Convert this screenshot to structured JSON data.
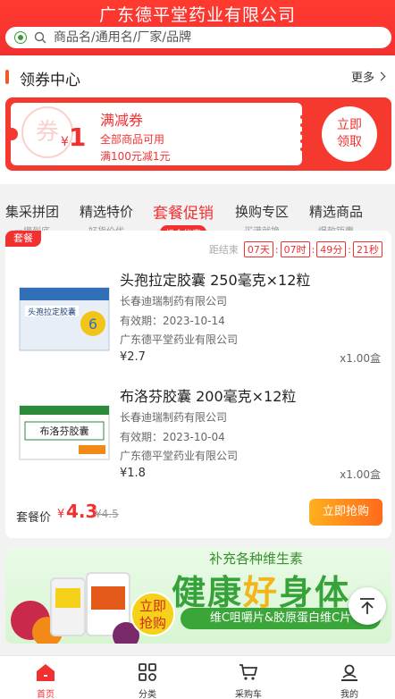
{
  "header": {
    "title": "广东德平堂药业有限公司",
    "search_placeholder": "商品名/通用名/厂家/品牌"
  },
  "coupon_center": {
    "title": "领券中心",
    "more": "更多",
    "coupon": {
      "watermark": "券",
      "currency": "¥",
      "amount": "1",
      "name": "满减券",
      "scope": "全部商品可用",
      "condition": "满100元减1元",
      "claim_line1": "立即",
      "claim_line2": "领取"
    }
  },
  "tabs": [
    {
      "label": "集采拼团",
      "sub": "一埋到底"
    },
    {
      "label": "精选特价",
      "sub": "好货价优"
    },
    {
      "label": "套餐促销",
      "sub": "组合优惠"
    },
    {
      "label": "换购专区",
      "sub": "买满就换"
    },
    {
      "label": "精选商品",
      "sub": "爆款钜惠"
    }
  ],
  "package": {
    "badge": "套餐",
    "countdown_label": "距结束",
    "days": "07天",
    "hours": "07时",
    "minutes": "49分",
    "seconds": "21秒",
    "products": [
      {
        "title": "头孢拉定胶囊 250毫克×12粒",
        "maker": "长春迪瑞制药有限公司",
        "expiry": "有效期：2023-10-14",
        "seller": "广东德平堂药业有限公司",
        "price": "¥2.7",
        "qty": "x1.00盒",
        "box_label": "头孢拉定胶囊"
      },
      {
        "title": "布洛芬胶囊 200毫克×12粒",
        "maker": "长春迪瑞制药有限公司",
        "expiry": "有效期：2023-10-04",
        "seller": "广东德平堂药业有限公司",
        "price": "¥1.8",
        "qty": "x1.00盒",
        "box_label": "布洛芬胶囊"
      }
    ],
    "price_label": "套餐价",
    "price_currency": "¥",
    "price": "4.3",
    "original_price": "¥4.5",
    "buy_label": "立即抢购"
  },
  "banner": {
    "sub": "补充各种维生素",
    "main_a": "健康",
    "main_hl": "好",
    "main_b": "身体",
    "strip": "维C咀嚼片&胶原蛋白维C片",
    "buy_line1": "立即",
    "buy_line2": "抢购"
  },
  "tabbar": [
    {
      "label": "首页",
      "icon": "home-icon"
    },
    {
      "label": "分类",
      "icon": "category-icon"
    },
    {
      "label": "采购车",
      "icon": "cart-icon"
    },
    {
      "label": "我的",
      "icon": "user-icon"
    }
  ],
  "colors": {
    "brand_red": "#f23030",
    "buy_gradient_start": "#ffb01f",
    "buy_gradient_end": "#ff6a1a",
    "banner_green": "#36a33a"
  }
}
